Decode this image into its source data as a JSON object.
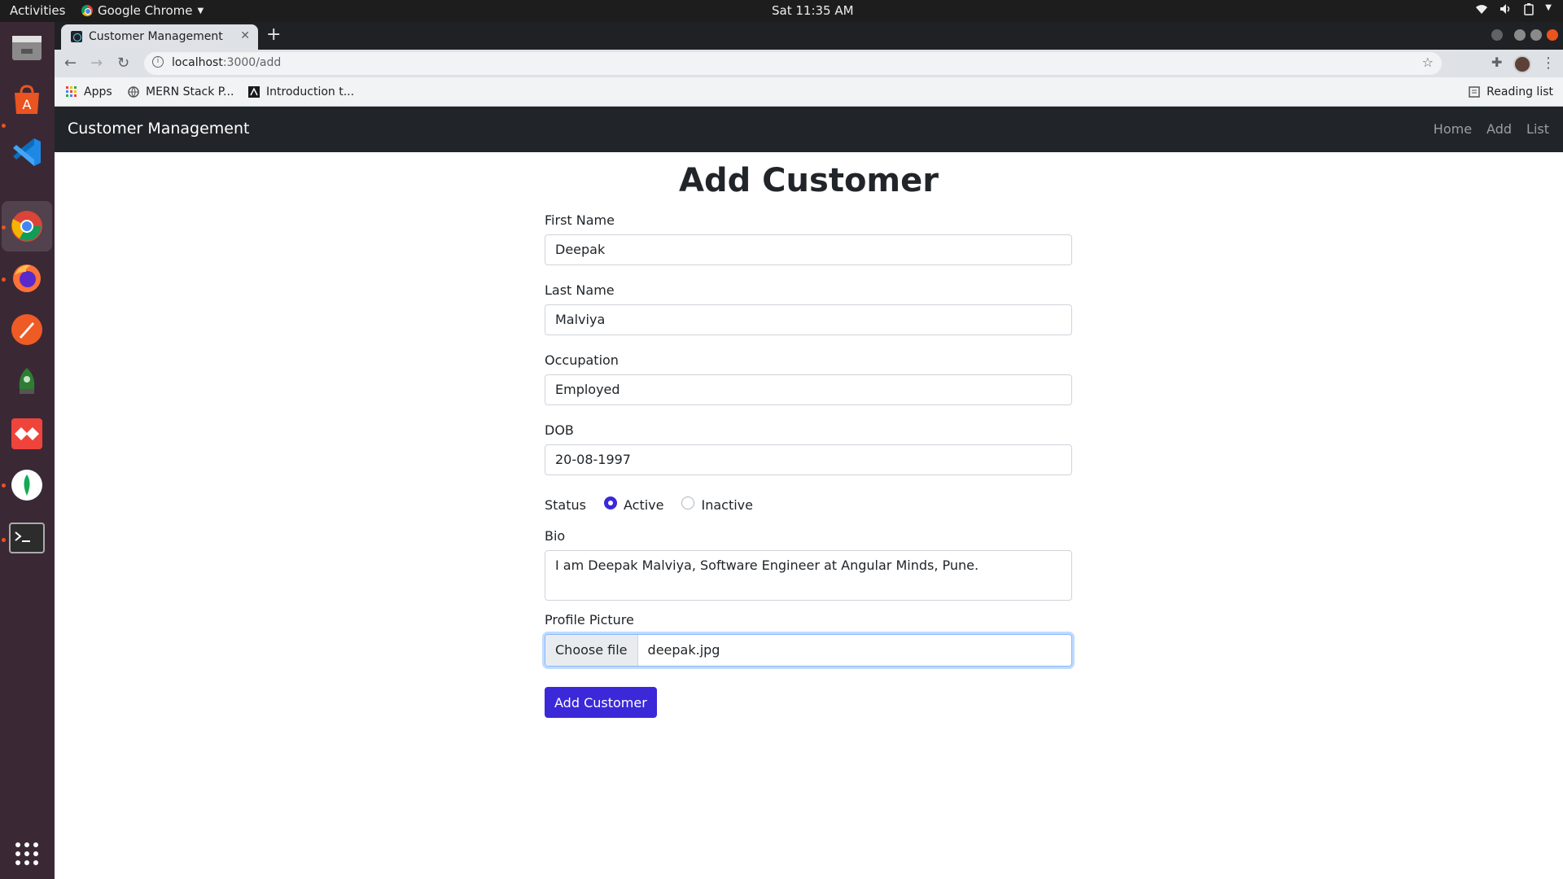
{
  "system": {
    "activities": "Activities",
    "app_menu": "Google Chrome",
    "clock": "Sat 11:35 AM"
  },
  "dock": {
    "items": [
      "files-icon",
      "software-store-icon",
      "vscode-icon",
      "chrome-icon",
      "firefox-icon",
      "postman-icon",
      "robo3t-icon",
      "anydesk-icon",
      "mongodb-compass-icon",
      "terminal-icon",
      "show-apps-icon"
    ]
  },
  "browser": {
    "tab_title": "Customer Management",
    "url_host": "localhost",
    "url_path": ":3000/add",
    "bookmarks": [
      "Apps",
      "MERN Stack P...",
      "Introduction t..."
    ],
    "reading_list": "Reading list"
  },
  "navbar": {
    "brand": "Customer Management",
    "links": [
      "Home",
      "Add",
      "List"
    ]
  },
  "form": {
    "heading": "Add Customer",
    "first_name": {
      "label": "First Name",
      "value": "Deepak"
    },
    "last_name": {
      "label": "Last Name",
      "value": "Malviya"
    },
    "occupation": {
      "label": "Occupation",
      "value": "Employed"
    },
    "dob": {
      "label": "DOB",
      "value": "20-08-1997"
    },
    "status": {
      "label": "Status",
      "options": [
        "Active",
        "Inactive"
      ],
      "selected": "Active"
    },
    "bio": {
      "label": "Bio",
      "value": "I am Deepak Malviya, Software Engineer at Angular Minds, Pune."
    },
    "profile_picture": {
      "label": "Profile Picture",
      "button": "Choose file",
      "filename": "deepak.jpg"
    },
    "submit": "Add Customer"
  },
  "colors": {
    "primary": "#3a28d9",
    "navbar": "#212529",
    "dock": "#3b2835"
  }
}
